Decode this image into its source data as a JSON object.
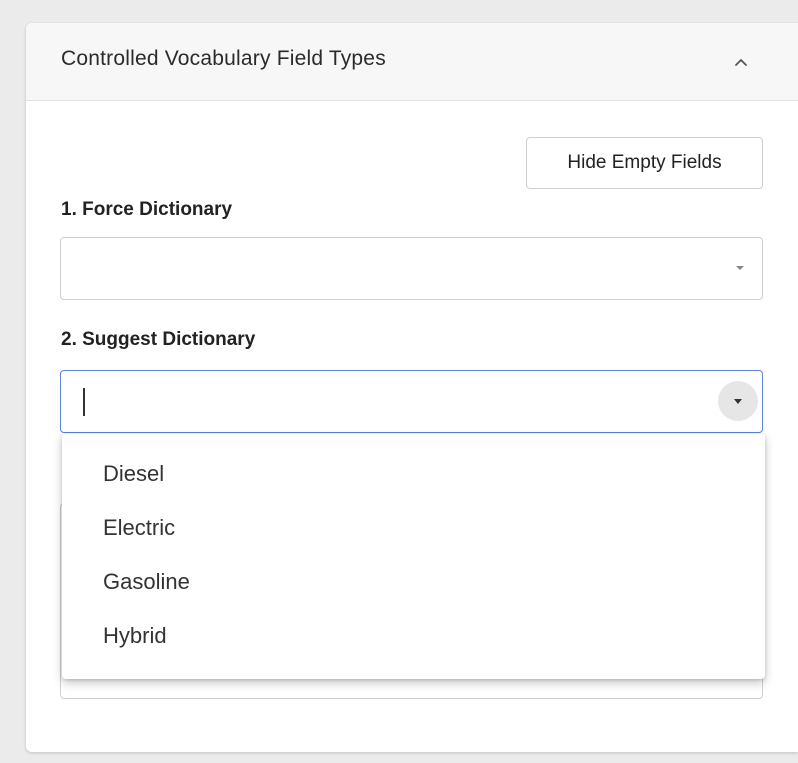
{
  "panel": {
    "title": "Controlled Vocabulary Field Types",
    "collapse_icon": "chevron-up-icon"
  },
  "toolbar": {
    "hide_empty_label": "Hide Empty Fields"
  },
  "fields": [
    {
      "label": "1. Force Dictionary",
      "value": ""
    },
    {
      "label": "2. Suggest Dictionary",
      "value": ""
    }
  ],
  "dropdown": {
    "options": [
      "Diesel",
      "Electric",
      "Gasoline",
      "Hybrid"
    ]
  },
  "colors": {
    "focus_border": "#5b83d6",
    "header_bg": "#f7f7f7",
    "page_bg": "#ebebeb"
  }
}
